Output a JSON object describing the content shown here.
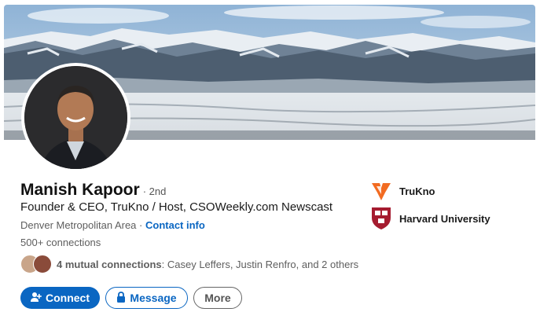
{
  "profile": {
    "name": "Manish Kapoor",
    "degree": "· 2nd",
    "headline": "Founder & CEO, TruKno / Host, CSOWeekly.com Newscast",
    "location": "Denver Metropolitan Area",
    "separator": " · ",
    "contact_info": "Contact info",
    "connections": "500+ connections",
    "mutual_bold": "4 mutual connections",
    "mutual_rest": ": Casey Leffers, Justin Renfro, and 2 others"
  },
  "actions": {
    "connect": "Connect",
    "message": "Message",
    "more": "More"
  },
  "organizations": [
    {
      "name": "TruKno",
      "icon": "trukno-logo-icon"
    },
    {
      "name": "Harvard University",
      "icon": "harvard-shield-icon"
    }
  ],
  "colors": {
    "brand_blue": "#0a66c2",
    "trukno_orange": "#f26b21",
    "harvard_crimson": "#a51c30"
  }
}
